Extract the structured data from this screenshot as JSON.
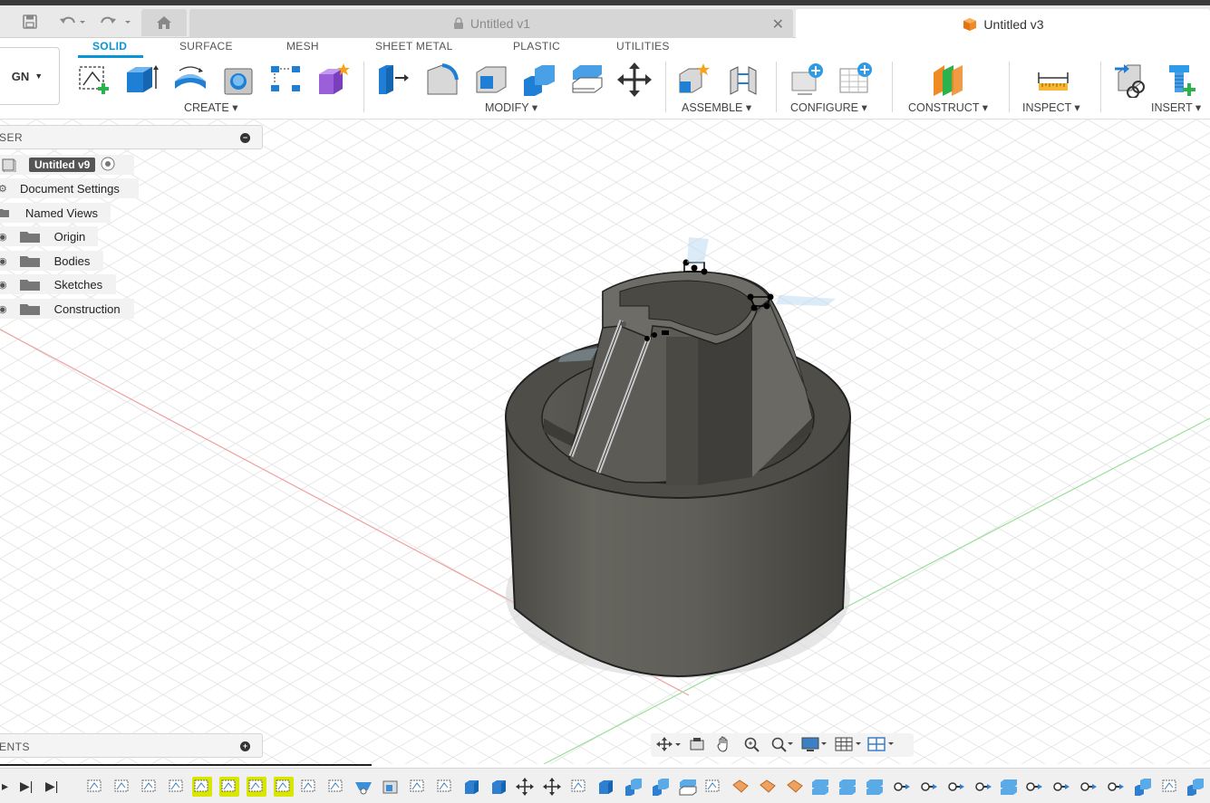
{
  "tabs": {
    "doc1": "Untitled v1",
    "doc2": "Untitled v3"
  },
  "ribbon": {
    "workspace": "GN",
    "tabs": [
      "SOLID",
      "SURFACE",
      "MESH",
      "SHEET METAL",
      "PLASTIC",
      "UTILITIES"
    ],
    "groups": [
      "CREATE",
      "MODIFY",
      "ASSEMBLE",
      "CONFIGURE",
      "CONSTRUCT",
      "INSPECT",
      "INSERT"
    ]
  },
  "browser": {
    "title": "SER",
    "root": "Untitled v9",
    "items": [
      "Document Settings",
      "Named Views",
      "Origin",
      "Bodies",
      "Sketches",
      "Construction"
    ]
  },
  "comments": {
    "title": "ENTS"
  },
  "colors": {
    "accent": "#0696d7",
    "model": "#5e5d57",
    "timeline_highlight": "#d8e600"
  }
}
